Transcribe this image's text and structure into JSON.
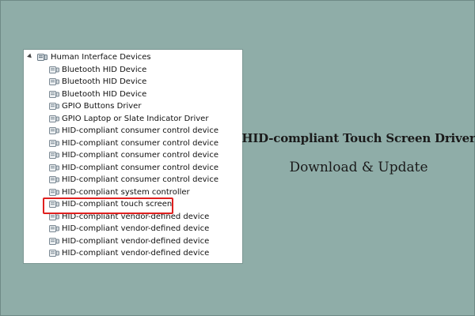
{
  "device_manager": {
    "root": {
      "label": "Human Interface Devices",
      "expanded": true,
      "icon": "hid-category-icon"
    },
    "items": [
      {
        "label": "Bluetooth HID Device",
        "icon": "hid-device-icon"
      },
      {
        "label": "Bluetooth HID Device",
        "icon": "hid-device-icon"
      },
      {
        "label": "Bluetooth HID Device",
        "icon": "hid-device-icon"
      },
      {
        "label": "GPIO Buttons Driver",
        "icon": "hid-device-icon"
      },
      {
        "label": "GPIO Laptop or Slate Indicator Driver",
        "icon": "hid-device-icon"
      },
      {
        "label": "HID-compliant consumer control device",
        "icon": "hid-device-icon"
      },
      {
        "label": "HID-compliant consumer control device",
        "icon": "hid-device-icon"
      },
      {
        "label": "HID-compliant consumer control device",
        "icon": "hid-device-icon"
      },
      {
        "label": "HID-compliant consumer control device",
        "icon": "hid-device-icon"
      },
      {
        "label": "HID-compliant consumer control device",
        "icon": "hid-device-icon"
      },
      {
        "label": "HID-compliant system controller",
        "icon": "hid-device-icon"
      },
      {
        "label": "HID-compliant touch screen",
        "icon": "hid-device-icon",
        "highlighted": true
      },
      {
        "label": "HID-compliant vendor-defined device",
        "icon": "hid-device-icon"
      },
      {
        "label": "HID-compliant vendor-defined device",
        "icon": "hid-device-icon"
      },
      {
        "label": "HID-compliant vendor-defined device",
        "icon": "hid-device-icon"
      },
      {
        "label": "HID-compliant vendor-defined device",
        "icon": "hid-device-icon"
      }
    ],
    "highlight_color": "#e0201f"
  },
  "caption": {
    "title": "HID-compliant Touch Screen Driver",
    "subtitle": "Download & Update"
  },
  "colors": {
    "background": "#8fada8",
    "panel": "#ffffff"
  }
}
